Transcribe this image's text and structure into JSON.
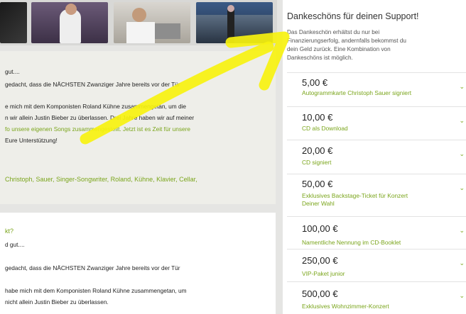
{
  "thumbnails": [
    {
      "label": "thumbnail-1"
    },
    {
      "label": "thumbnail-2"
    },
    {
      "label": "thumbnail-3"
    },
    {
      "label": "thumbnail-4"
    }
  ],
  "post1": {
    "lines": [
      "gut....",
      "gedacht, dass die NÄCHSTEN Zwanziger Jahre bereits vor der Tür",
      "",
      "e mich mit dem Komponisten Roland Kühne zusammengetan, um die",
      "n wir allein Justin Bieber zu überlassen. Drei Jahre haben wir auf meiner",
      "fo unsere eigenen Songs zusammengestellt. Jetzt ist es Zeit für unsere",
      "Eure Unterstützung!"
    ],
    "tags": "Christoph,  Sauer,  Singer-Songwriter,  Roland,  Kühne,  Klavier,  Cellar,"
  },
  "post2": {
    "question": "kt?",
    "lines": [
      "d gut....",
      "",
      "gedacht, dass die NÄCHSTEN Zwanziger Jahre bereits vor der Tür",
      "",
      "habe mich mit dem Komponisten Roland Kühne zusammengetan, um",
      "nicht allein Justin Bieber zu überlassen."
    ]
  },
  "rewards_panel": {
    "title": "Dankeschöns für deinen Support!",
    "intro": [
      "Das Dankeschön erhältst du nur bei",
      "Finanzierungserfolg, andernfalls bekommst du",
      "dein Geld zurück. Eine Kombination von",
      "Dankeschöns ist möglich."
    ],
    "items": [
      {
        "price": "5,00 €",
        "desc": [
          "Autogrammkarte Christoph Sauer signiert"
        ]
      },
      {
        "price": "10,00 €",
        "desc": [
          "CD als Download"
        ]
      },
      {
        "price": "20,00 €",
        "desc": [
          "CD signiert"
        ]
      },
      {
        "price": "50,00 €",
        "desc": [
          "Exklusives Backstage-Ticket für Konzert",
          "Deiner Wahl"
        ]
      },
      {
        "price": "100,00 €",
        "desc": [
          "Namentliche Nennung im CD-Booklet"
        ]
      },
      {
        "price": "250,00 €",
        "desc": [
          "VIP-Paket junior"
        ]
      },
      {
        "price": "500,00 €",
        "desc": [
          "Exklusives Wohnzimmer-Konzert"
        ]
      }
    ],
    "chevron": "⌄"
  },
  "colors": {
    "accent_green": "#7aa51b",
    "annotation_yellow": "#f7f20f"
  },
  "icons": {
    "expand": "chevron-down-icon",
    "annotation": "yellow-arrow-annotation"
  }
}
